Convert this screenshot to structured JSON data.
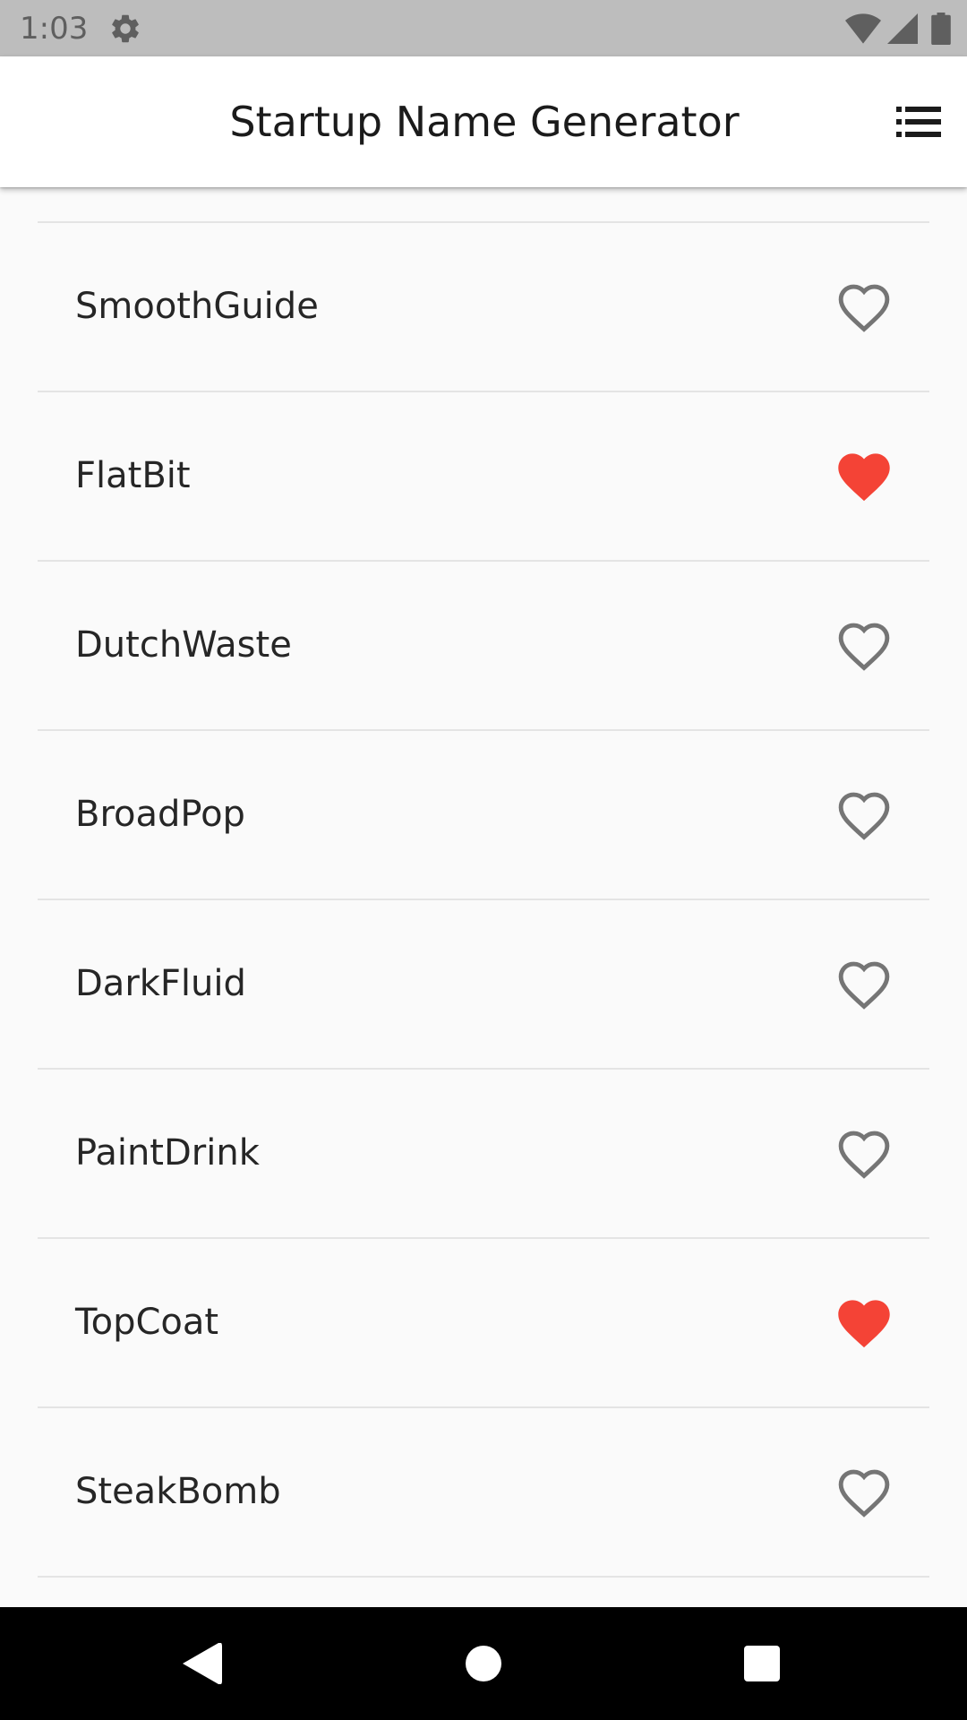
{
  "status_bar": {
    "time": "1:03",
    "icons": [
      "settings-icon",
      "wifi-icon",
      "cell-signal-icon",
      "battery-icon"
    ]
  },
  "app_bar": {
    "title": "Startup Name Generator",
    "action_icon": "list-icon"
  },
  "colors": {
    "saved_heart": "#f44336",
    "unsaved_heart": "#757575"
  },
  "list": {
    "items": [
      {
        "name": "SmoothGuide",
        "saved": false
      },
      {
        "name": "FlatBit",
        "saved": true
      },
      {
        "name": "DutchWaste",
        "saved": false
      },
      {
        "name": "BroadPop",
        "saved": false
      },
      {
        "name": "DarkFluid",
        "saved": false
      },
      {
        "name": "PaintDrink",
        "saved": false
      },
      {
        "name": "TopCoat",
        "saved": true
      },
      {
        "name": "SteakBomb",
        "saved": false
      }
    ]
  },
  "nav_bar": {
    "icons": [
      "back-icon",
      "home-icon",
      "recents-icon"
    ]
  }
}
